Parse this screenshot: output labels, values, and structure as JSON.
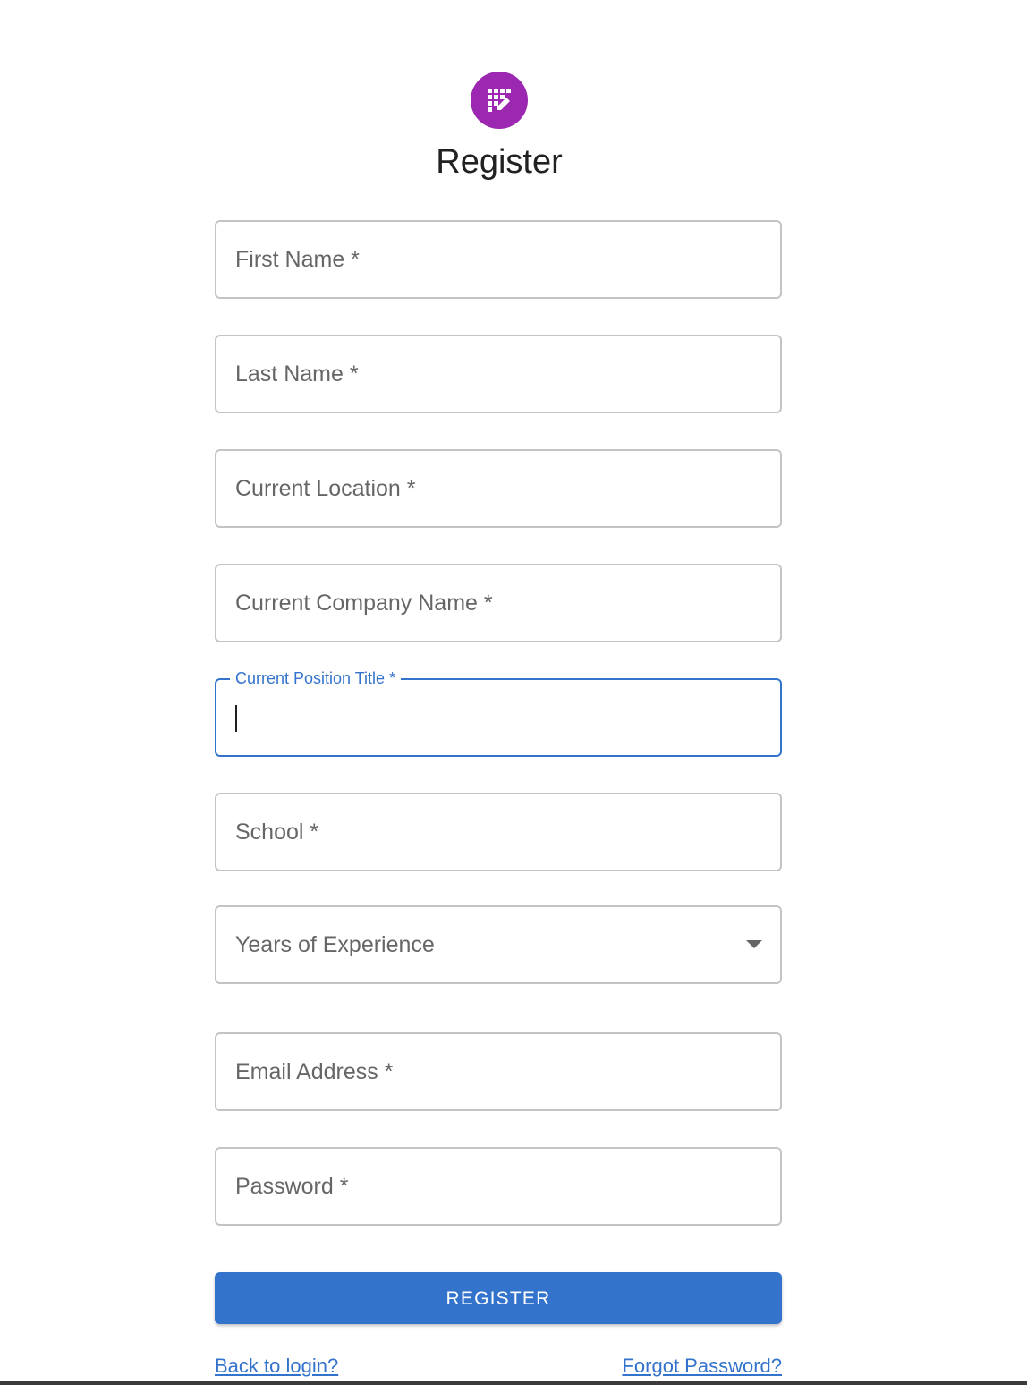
{
  "header": {
    "icon": "register-form-icon",
    "title": "Register",
    "icon_color": "#9c27b0"
  },
  "form": {
    "fields": [
      {
        "label": "First Name *",
        "value": "",
        "state": "empty"
      },
      {
        "label": "Last Name *",
        "value": "",
        "state": "empty"
      },
      {
        "label": "Current Location *",
        "value": "",
        "state": "empty"
      },
      {
        "label": "Current Company Name *",
        "value": "",
        "state": "empty"
      },
      {
        "label": "Current Position Title *",
        "value": "",
        "state": "focused"
      },
      {
        "label": "School *",
        "value": "",
        "state": "empty"
      },
      {
        "label": "Years of Experience",
        "value": "",
        "state": "select"
      },
      {
        "label": "Email Address *",
        "value": "",
        "state": "empty"
      },
      {
        "label": "Password *",
        "value": "",
        "state": "empty"
      }
    ],
    "submit_label": "REGISTER"
  },
  "links": {
    "back_to_login": "Back to login?",
    "forgot_password": "Forgot Password?"
  },
  "colors": {
    "accent": "#3473cc",
    "border": "#c4c4c4",
    "label": "#666666"
  }
}
